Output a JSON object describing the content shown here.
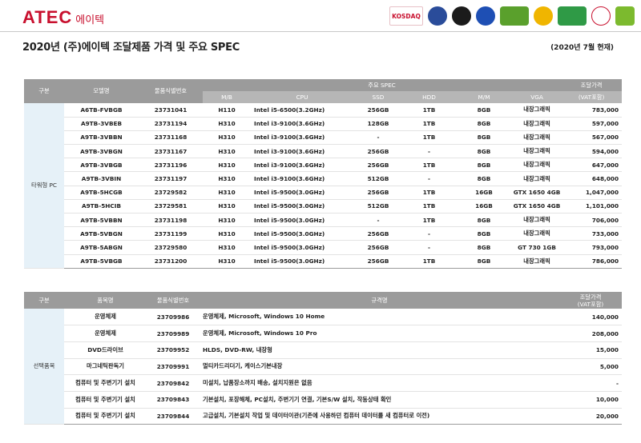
{
  "brand": {
    "logo_text": "ATEC",
    "logo_korean": "에이텍",
    "cert_labels": [
      "KOSDAQ",
      "",
      "",
      "",
      "",
      "",
      "",
      "",
      ""
    ]
  },
  "page": {
    "title": "2020년 (주)에이텍 조달제품 가격 및 주요 SPEC",
    "as_of": "(2020년 7월 현재)"
  },
  "pc_table": {
    "headers": {
      "category": "구분",
      "model": "모델명",
      "code": "물품식별번호",
      "spec_group": "주요 SPEC",
      "price_top": "조달가격",
      "price_bottom": "(VAT포함)",
      "spec_cols": [
        "M/B",
        "CPU",
        "SSD",
        "HDD",
        "M/M",
        "VGA"
      ]
    },
    "group_label": "타워형 PC",
    "rows": [
      {
        "model": "A6TB-FVBGB",
        "code": "23731041",
        "mb": "H110",
        "cpu": "Intel i5-6500(3.2GHz)",
        "ssd": "256GB",
        "hdd": "1TB",
        "mm": "8GB",
        "vga": "내장그래픽",
        "price": "783,000"
      },
      {
        "model": "A9TB-3VBEB",
        "code": "23731194",
        "mb": "H310",
        "cpu": "Intel i3-9100(3.6GHz)",
        "ssd": "128GB",
        "hdd": "1TB",
        "mm": "8GB",
        "vga": "내장그래픽",
        "price": "597,000"
      },
      {
        "model": "A9TB-3VBBN",
        "code": "23731168",
        "mb": "H310",
        "cpu": "Intel i3-9100(3.6GHz)",
        "ssd": "-",
        "hdd": "1TB",
        "mm": "8GB",
        "vga": "내장그래픽",
        "price": "567,000"
      },
      {
        "model": "A9TB-3VBGN",
        "code": "23731167",
        "mb": "H310",
        "cpu": "Intel i3-9100(3.6GHz)",
        "ssd": "256GB",
        "hdd": "-",
        "mm": "8GB",
        "vga": "내장그래픽",
        "price": "594,000"
      },
      {
        "model": "A9TB-3VBGB",
        "code": "23731196",
        "mb": "H310",
        "cpu": "Intel i3-9100(3.6GHz)",
        "ssd": "256GB",
        "hdd": "1TB",
        "mm": "8GB",
        "vga": "내장그래픽",
        "price": "647,000"
      },
      {
        "model": "A9TB-3VBIN",
        "code": "23731197",
        "mb": "H310",
        "cpu": "Intel i3-9100(3.6GHz)",
        "ssd": "512GB",
        "hdd": "-",
        "mm": "8GB",
        "vga": "내장그래픽",
        "price": "648,000"
      },
      {
        "model": "A9TB-5HCGB",
        "code": "23729582",
        "mb": "H310",
        "cpu": "Intel i5-9500(3.0GHz)",
        "ssd": "256GB",
        "hdd": "1TB",
        "mm": "16GB",
        "vga": "GTX 1650 4GB",
        "price": "1,047,000"
      },
      {
        "model": "A9TB-5HCIB",
        "code": "23729581",
        "mb": "H310",
        "cpu": "Intel i5-9500(3.0GHz)",
        "ssd": "512GB",
        "hdd": "1TB",
        "mm": "16GB",
        "vga": "GTX 1650 4GB",
        "price": "1,101,000"
      },
      {
        "model": "A9TB-5VBBN",
        "code": "23731198",
        "mb": "H310",
        "cpu": "Intel i5-9500(3.0GHz)",
        "ssd": "-",
        "hdd": "1TB",
        "mm": "8GB",
        "vga": "내장그래픽",
        "price": "706,000"
      },
      {
        "model": "A9TB-5VBGN",
        "code": "23731199",
        "mb": "H310",
        "cpu": "Intel i5-9500(3.0GHz)",
        "ssd": "256GB",
        "hdd": "-",
        "mm": "8GB",
        "vga": "내장그래픽",
        "price": "733,000"
      },
      {
        "model": "A9TB-5ABGN",
        "code": "23729580",
        "mb": "H310",
        "cpu": "Intel i5-9500(3.0GHz)",
        "ssd": "256GB",
        "hdd": "-",
        "mm": "8GB",
        "vga": "GT 730 1GB",
        "price": "793,000"
      },
      {
        "model": "A9TB-5VBGB",
        "code": "23731200",
        "mb": "H310",
        "cpu": "Intel i5-9500(3.0GHz)",
        "ssd": "256GB",
        "hdd": "1TB",
        "mm": "8GB",
        "vga": "내장그래픽",
        "price": "786,000"
      }
    ]
  },
  "option_table": {
    "headers": {
      "category": "구분",
      "item": "품목명",
      "code": "물품식별번호",
      "spec": "규격명",
      "price_top": "조달가격",
      "price_bottom": "(VAT포함)"
    },
    "group_label": "선택품목",
    "rows": [
      {
        "item": "운영체제",
        "code": "23709986",
        "spec": "운영체제, Microsoft, Windows 10 Home",
        "price": "140,000"
      },
      {
        "item": "운영체제",
        "code": "23709989",
        "spec": "운영체제, Microsoft, Windows 10 Pro",
        "price": "208,000"
      },
      {
        "item": "DVD드라이브",
        "code": "23709952",
        "spec": "HLDS, DVD-RW, 내장형",
        "price": "15,000"
      },
      {
        "item": "마그네틱판독기",
        "code": "23709991",
        "spec": "멀티카드리더기, 케이스기본내장",
        "price": "5,000"
      },
      {
        "item": "컴퓨터 및 주변기기 설치",
        "code": "23709842",
        "spec": "미설치, 납품장소까지 배송, 설치지원은 없음",
        "price": "-"
      },
      {
        "item": "컴퓨터 및 주변기기 설치",
        "code": "23709843",
        "spec": "기본설치, 포장해체, PC설치, 주변기기 연결, 기본S/W 설치, 작동상태 확인",
        "price": "10,000"
      },
      {
        "item": "컴퓨터 및 주변기기 설치",
        "code": "23709844",
        "spec": "고급설치, 기본설치 작업 및 데이터이관(기존에 사용하던 컴퓨터 데이터를 새 컴퓨터로 이전)",
        "price": "20,000"
      }
    ]
  },
  "colors": {
    "brand_red": "#c8102e",
    "header_gray": "#9b9b9b",
    "group_fill": "#e6f1f8"
  }
}
